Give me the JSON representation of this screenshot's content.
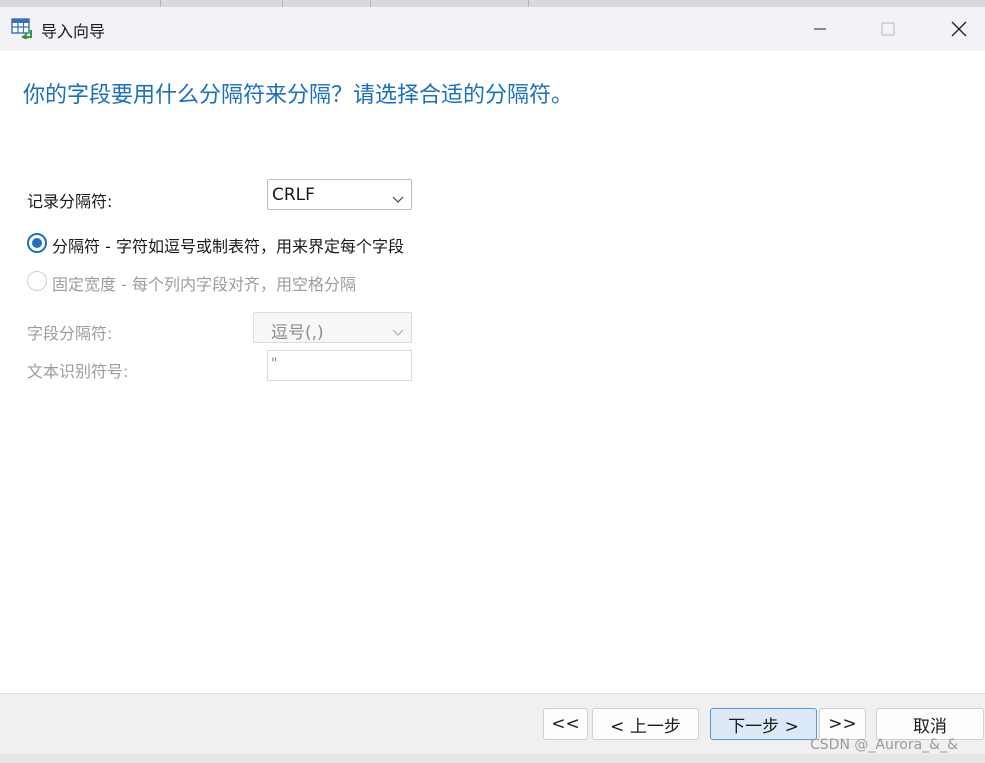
{
  "dialog": {
    "title": "导入向导",
    "heading": "你的字段要用什么分隔符来分隔？请选择合适的分隔符。"
  },
  "record_delimiter": {
    "label": "记录分隔符:",
    "value": "CRLF"
  },
  "options": {
    "delimited": "分隔符 - 字符如逗号或制表符，用来界定每个字段",
    "fixed_width": "固定宽度 - 每个列内字段对齐，用空格分隔"
  },
  "field_delimiter": {
    "label": "字段分隔符:",
    "value": "逗号(,)"
  },
  "text_qualifier": {
    "label": "文本识别符号:",
    "value": "\""
  },
  "buttons": {
    "first": "<<",
    "back": "< 上一步",
    "next": "下一步 >",
    "last": ">>",
    "cancel": "取消"
  },
  "watermark": "CSDN @_Aurora_&_&",
  "colors": {
    "heading": "#1a6fc0",
    "accent": "#1f6fc5",
    "primary_button_bg": "#dce9f7"
  }
}
